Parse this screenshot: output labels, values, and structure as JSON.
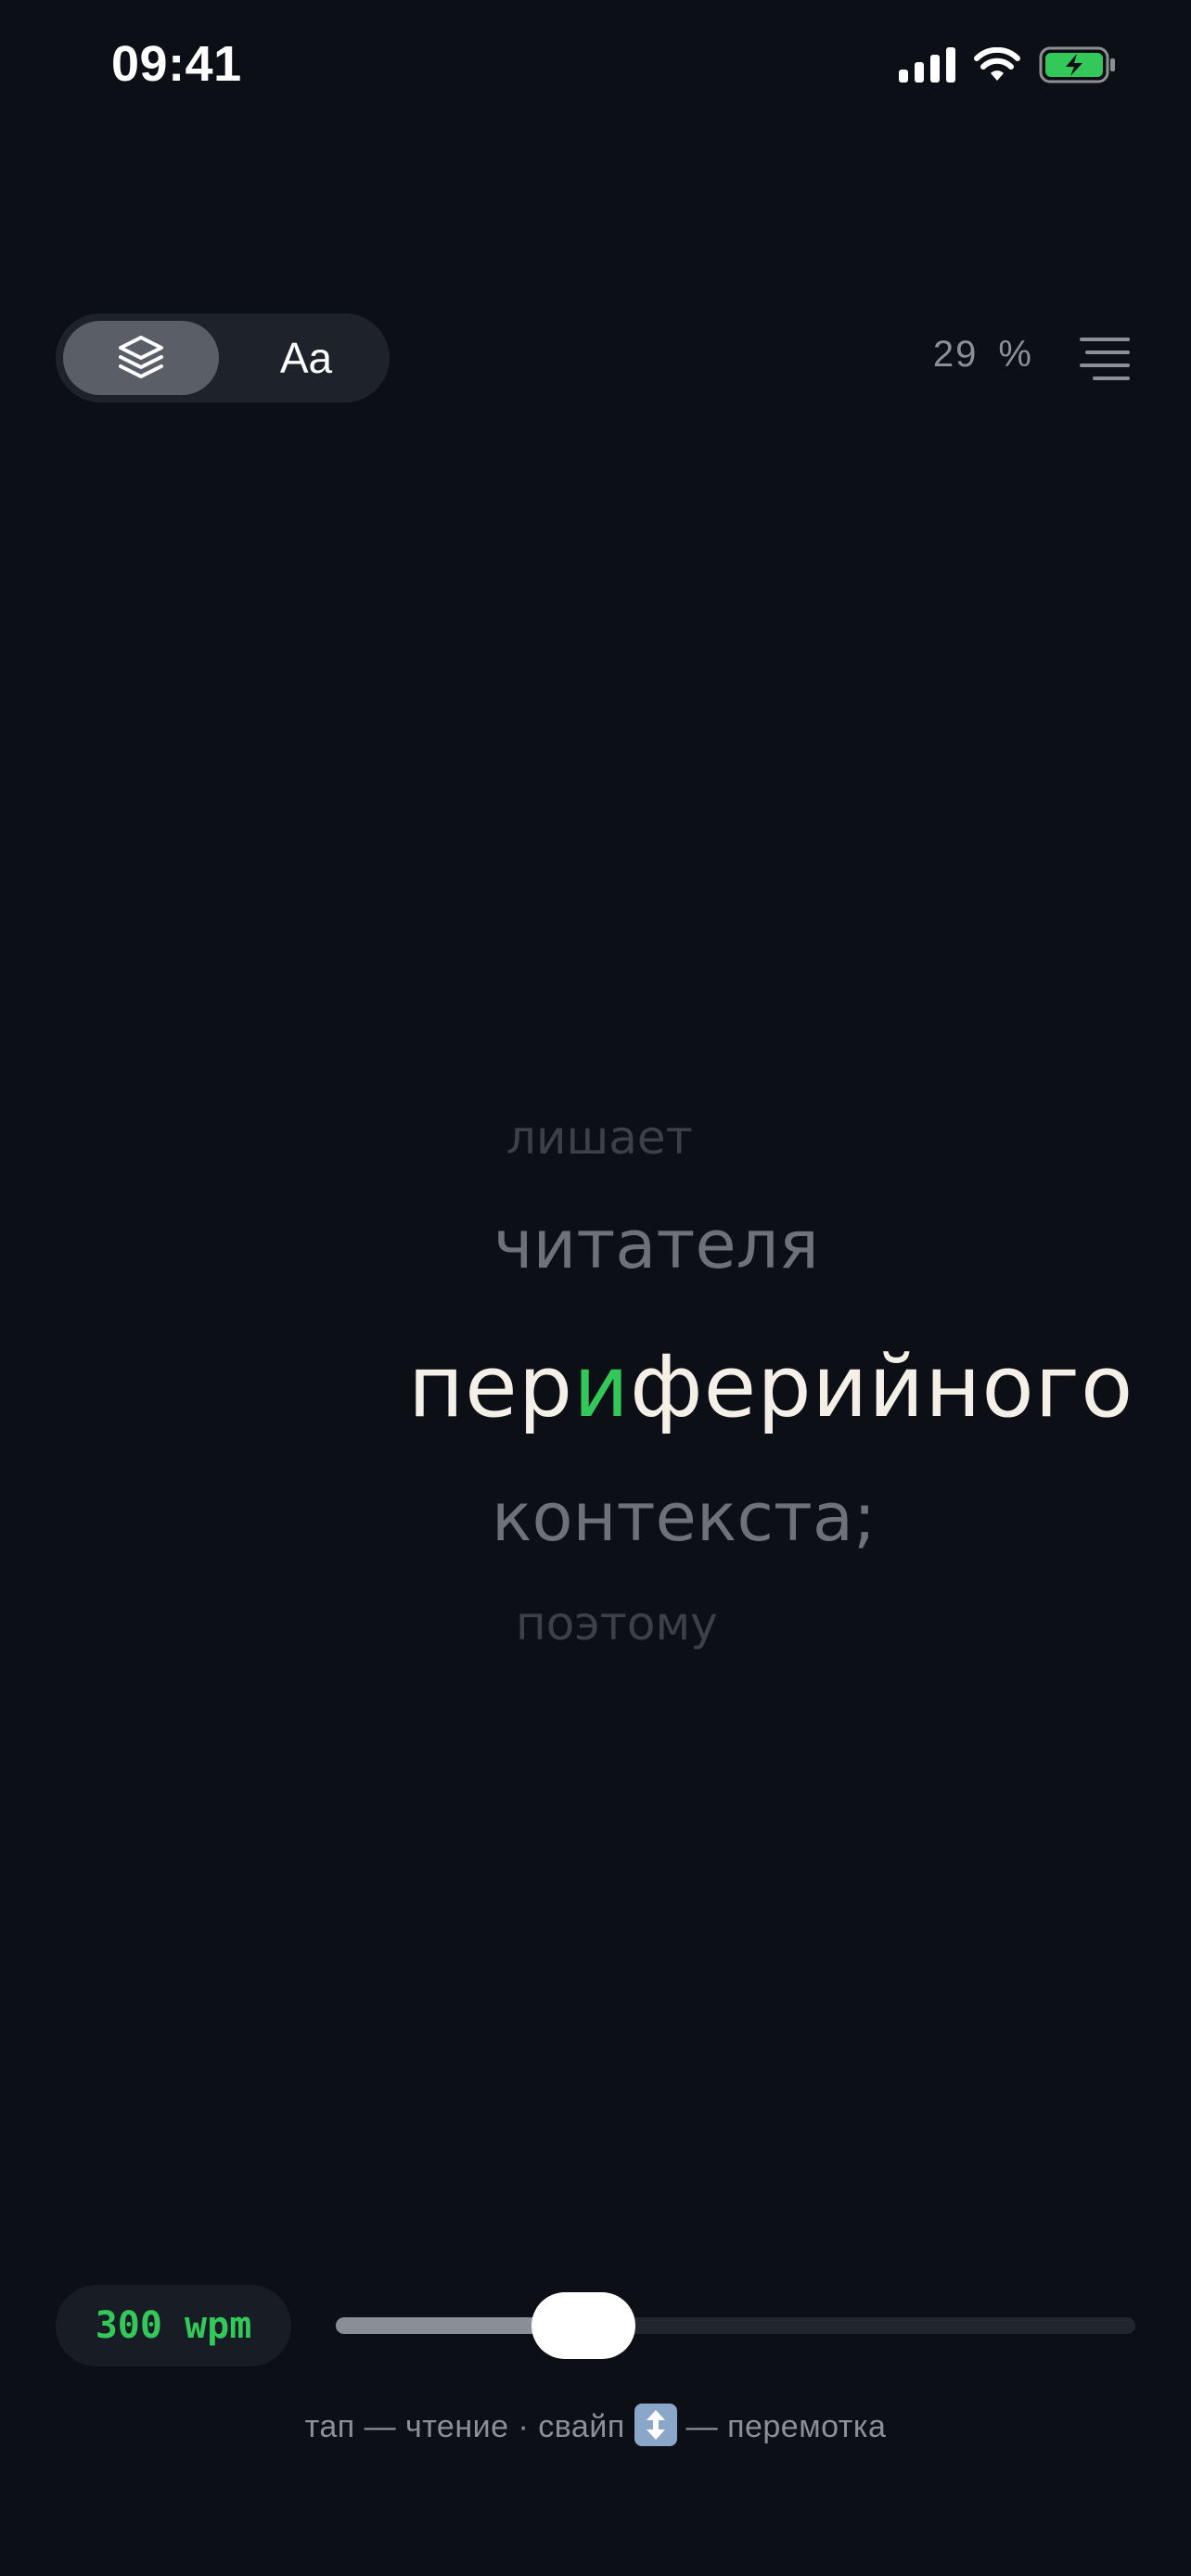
{
  "status_bar": {
    "time": "09:41"
  },
  "toolbar": {
    "mode_layers_icon": "layers-icon",
    "mode_font_label": "Aa",
    "progress_value": "29",
    "progress_unit": "%",
    "menu_icon": "list-lines-icon"
  },
  "reader": {
    "prev2": "лишает",
    "prev1": "читателя",
    "current_before": "пер",
    "current_focus": "и",
    "current_after": "ферийного",
    "next1": "контекста;",
    "next2": "поэтому"
  },
  "colors": {
    "background": "#0c0f15",
    "accent": "#34c759",
    "current_word": "#f4f0e7",
    "battery_fill": "#34c759"
  },
  "controls": {
    "wpm_label": "300 wpm",
    "speed_slider_fraction": 0.31,
    "hint_before": "тап — чтение · свайп ",
    "hint_after": " — перемотка"
  }
}
